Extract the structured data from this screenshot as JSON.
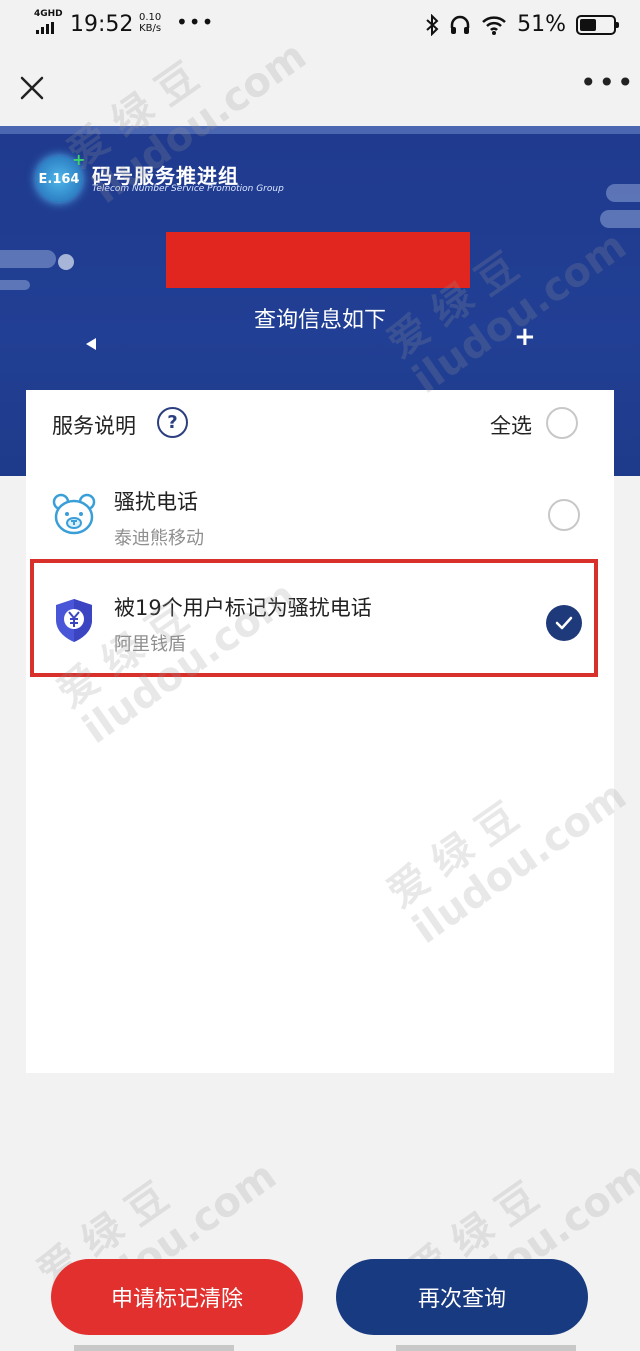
{
  "status_bar": {
    "network": "4GHD",
    "time": "19:52",
    "speed_value": "0.10",
    "speed_unit": "KB/s",
    "dots": "•••",
    "battery_pct": "51%",
    "battery_level": 0.51
  },
  "title_bar": {
    "close_icon": "close-icon",
    "more_icon": "more-icon",
    "more_label": "•••"
  },
  "banner": {
    "logo_text": "E.164",
    "org_name": "码号服务推进组",
    "org_subtitle": "Telecom Number Service Promotion Group",
    "query_title": "查询信息如下",
    "redaction_color": "#e0261f"
  },
  "card": {
    "service_label": "服务说明",
    "help_symbol": "?",
    "select_all_label": "全选",
    "items": [
      {
        "title": "骚扰电话",
        "source": "泰迪熊移动",
        "icon": "teddy-bear-icon",
        "checked": false
      },
      {
        "title": "被19个用户标记为骚扰电话",
        "source": "阿里钱盾",
        "icon": "yuan-shield-icon",
        "checked": true
      }
    ]
  },
  "actions": {
    "clear_label": "申请标记清除",
    "requery_label": "再次查询"
  },
  "watermarks": {
    "chinese": "爱 绿 豆",
    "domain": "iludou.com"
  },
  "colors": {
    "banner_blue": "#213f94",
    "accent_navy": "#1f3a7a",
    "danger_red": "#e1302d",
    "highlight_red": "#d8302b"
  }
}
